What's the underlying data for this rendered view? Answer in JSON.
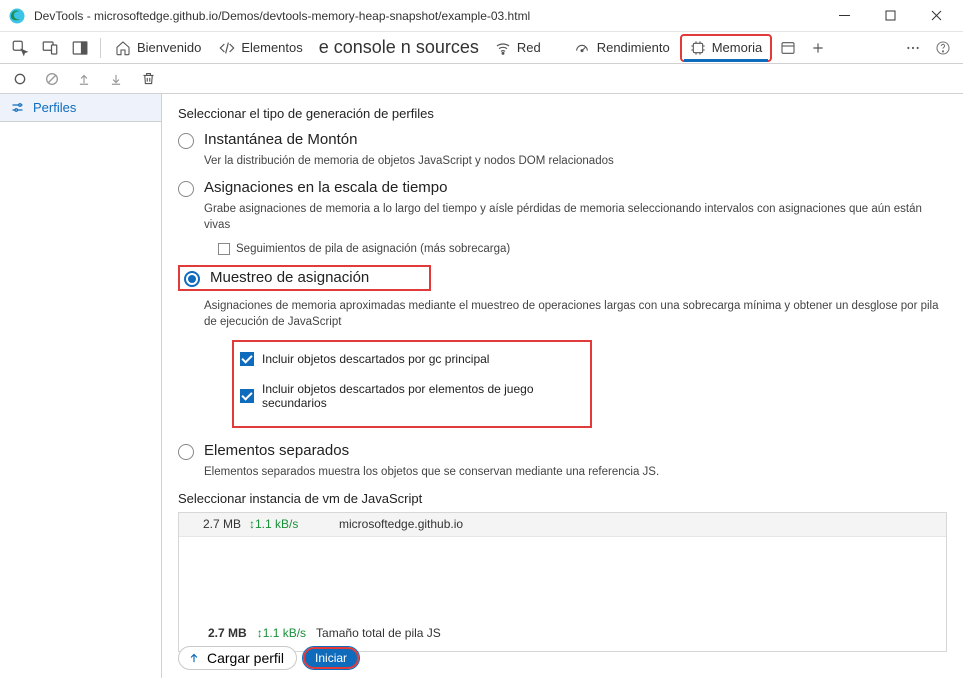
{
  "window": {
    "title": "DevTools - microsoftedge.github.io/Demos/devtools-memory-heap-snapshot/example-03.html"
  },
  "tabs": {
    "welcome": "Bienvenido",
    "elements": "Elementos",
    "console_mid": "e console n sources",
    "network": "Red",
    "performance": "Rendimiento",
    "memory": "Memoria"
  },
  "sidebar": {
    "profiles": "Perfiles"
  },
  "main": {
    "select_type": "Seleccionar el tipo de generación de perfiles",
    "heap": {
      "title": "Instantánea de Montón",
      "desc": "Ver la distribución de memoria de objetos JavaScript y nodos DOM relacionados"
    },
    "timeline": {
      "title": "Asignaciones en la escala de tiempo",
      "desc": "Grabe asignaciones de memoria a lo largo del tiempo y aísle pérdidas de memoria seleccionando intervalos con asignaciones que aún están vivas",
      "stack": "Seguimientos de pila de asignación (más sobrecarga)"
    },
    "sampling": {
      "title": "Muestreo de asignación",
      "desc": "Asignaciones de memoria aproximadas mediante el muestreo de operaciones largas con una sobrecarga mínima y obtener un desglose por pila de ejecución de JavaScript",
      "chk1": "Incluir objetos descartados por gc principal",
      "chk2": "Incluir objetos descartados por elementos de juego secundarios"
    },
    "detached": {
      "title": "Elementos separados",
      "desc": "Elementos separados muestra los objetos que se conservan mediante una referencia JS."
    },
    "vm": {
      "header": "Seleccionar instancia de vm de JavaScript",
      "row": {
        "size": "2.7 MB",
        "rate": "1.1 kB/s",
        "host": "microsoftedge.github.io"
      }
    },
    "footer": {
      "size": "2.7 MB",
      "rate": "1.1 kB/s",
      "total_label": "Tamaño total de pila JS",
      "load": "Cargar perfil",
      "start": "Iniciar"
    }
  }
}
